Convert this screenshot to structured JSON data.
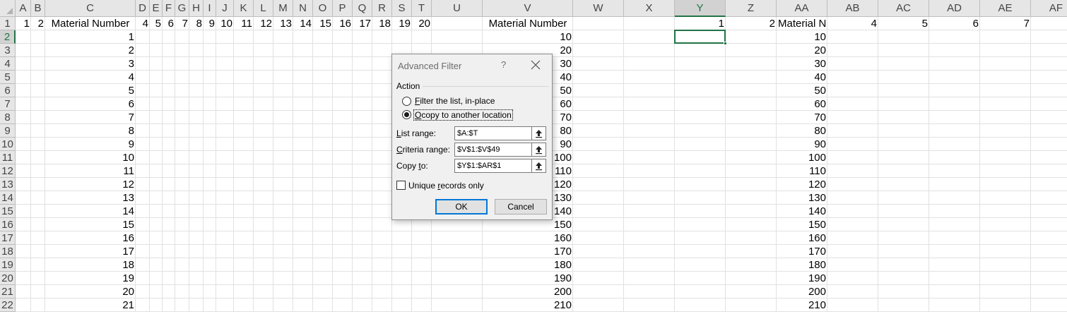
{
  "spreadsheet": {
    "columns": [
      "A",
      "B",
      "C",
      "D",
      "E",
      "F",
      "G",
      "H",
      "I",
      "J",
      "K",
      "L",
      "M",
      "N",
      "O",
      "P",
      "Q",
      "R",
      "S",
      "T",
      "U",
      "V",
      "W",
      "X",
      "Y",
      "Z",
      "AA",
      "AB",
      "AC",
      "AD",
      "AE",
      "AF"
    ],
    "selected_column": "Y",
    "selected_row": 2,
    "active_cell": "Y2",
    "row_numbers": [
      1,
      2,
      3,
      4,
      5,
      6,
      7,
      8,
      9,
      10,
      11,
      12,
      13,
      14,
      15,
      16,
      17,
      18,
      19,
      20,
      21,
      22
    ],
    "row1": {
      "A": "1",
      "B": "2",
      "C": "Material Number",
      "D": "4",
      "E": "5",
      "F": "6",
      "G": "7",
      "H": "8",
      "I": "9",
      "J": "10",
      "K": "11",
      "L": "12",
      "M": "13",
      "N": "14",
      "O": "15",
      "P": "16",
      "Q": "17",
      "R": "18",
      "S": "19",
      "T": "20",
      "V": "Material Number",
      "Y": "1",
      "Z": "2",
      "AA": "Material N",
      "AB": "4",
      "AC": "5",
      "AD": "6",
      "AE": "7"
    },
    "column_c_values": [
      "1",
      "2",
      "3",
      "4",
      "5",
      "6",
      "7",
      "8",
      "9",
      "10",
      "11",
      "12",
      "13",
      "14",
      "15",
      "16",
      "17",
      "18",
      "19",
      "20",
      "21"
    ],
    "column_v_values": [
      "10",
      "20",
      "30",
      "40",
      "50",
      "60",
      "70",
      "80",
      "90",
      "100",
      "110",
      "120",
      "130",
      "140",
      "150",
      "160",
      "170",
      "180",
      "190",
      "200",
      "210"
    ],
    "column_aa_values": [
      "10",
      "20",
      "30",
      "40",
      "50",
      "60",
      "70",
      "80",
      "90",
      "100",
      "110",
      "120",
      "130",
      "140",
      "150",
      "160",
      "170",
      "180",
      "190",
      "200",
      "210"
    ]
  },
  "dialog": {
    "title": "Advanced Filter",
    "help": "?",
    "action_label": "Action",
    "option_filter_in_place": {
      "hotkey": "F",
      "rest": "ilter the list, in-place",
      "selected": false
    },
    "option_copy": {
      "hotkey": "O",
      "rest": "copy to another location",
      "prefix": "",
      "selected": true
    },
    "list_range": {
      "hotkey": "L",
      "rest": "ist range:",
      "value": "$A:$T"
    },
    "criteria_range": {
      "hotkey": "C",
      "rest": "riteria range:",
      "value": "$V$1:$V$49"
    },
    "copy_to": {
      "pre": "Copy ",
      "hotkey": "t",
      "rest": "o:",
      "value": "$Y$1:$AR$1"
    },
    "unique": {
      "pre": "Unique ",
      "hotkey": "r",
      "rest": "ecords only",
      "checked": false
    },
    "ok_label": "OK",
    "cancel_label": "Cancel"
  }
}
